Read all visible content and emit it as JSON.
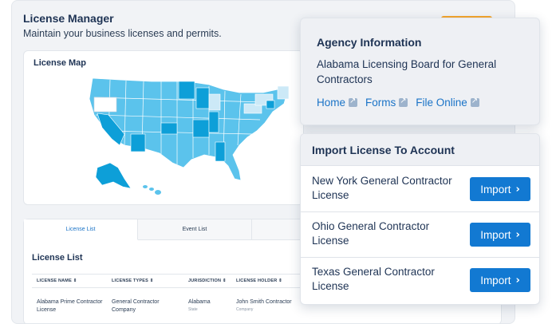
{
  "header": {
    "title": "License Manager",
    "subtitle": "Maintain your business licenses and permits."
  },
  "map": {
    "title": "License Map"
  },
  "tabs": [
    {
      "label": "License List",
      "active": true
    },
    {
      "label": "Event List",
      "active": false
    }
  ],
  "license_list": {
    "title": "License List",
    "columns": [
      "LICENSE NAME",
      "LICENSE TYPES",
      "JURISDICTION",
      "LICENSE HOLDER"
    ],
    "rows": [
      {
        "name": "Alabama Prime Contractor License",
        "type": "General Contractor Company",
        "jurisdiction": "Alabama",
        "jurisdiction_sub": "State",
        "holder": "John Smith Contractor",
        "holder_sub": "Company"
      }
    ]
  },
  "agency": {
    "title": "Agency Information",
    "name": "Alabama Licensing Board for General Contractors",
    "links": [
      "Home",
      "Forms",
      "File Online"
    ]
  },
  "import_panel": {
    "title": "Import License To Account",
    "button_label": "Import",
    "items": [
      "New York General Contractor License",
      "Ohio General Contractor License",
      "Texas General Contractor License"
    ]
  },
  "colors": {
    "accent": "#1279d2",
    "map_light": "#5bc3ec",
    "map_dark": "#0d9fd8",
    "map_pale": "#cce9f7",
    "orange": "#f4a52a"
  }
}
